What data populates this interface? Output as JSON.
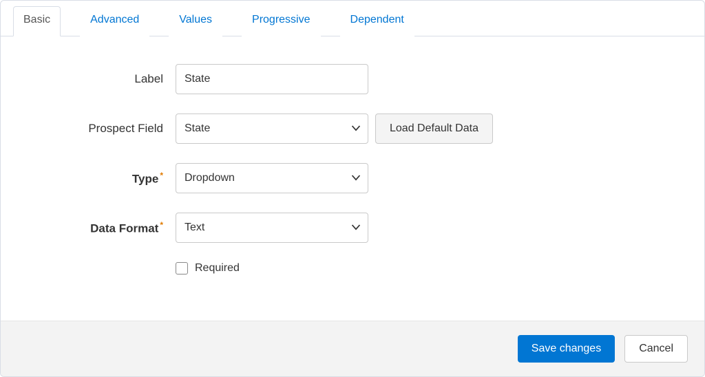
{
  "tabs": {
    "basic": "Basic",
    "advanced": "Advanced",
    "values": "Values",
    "progressive": "Progressive",
    "dependent": "Dependent"
  },
  "form": {
    "label_field": {
      "label": "Label",
      "value": "State"
    },
    "prospect_field": {
      "label": "Prospect Field",
      "value": "State",
      "load_btn": "Load Default Data"
    },
    "type_field": {
      "label": "Type",
      "value": "Dropdown"
    },
    "data_format": {
      "label": "Data Format",
      "value": "Text"
    },
    "required_label": "Required"
  },
  "footer": {
    "save": "Save changes",
    "cancel": "Cancel"
  }
}
